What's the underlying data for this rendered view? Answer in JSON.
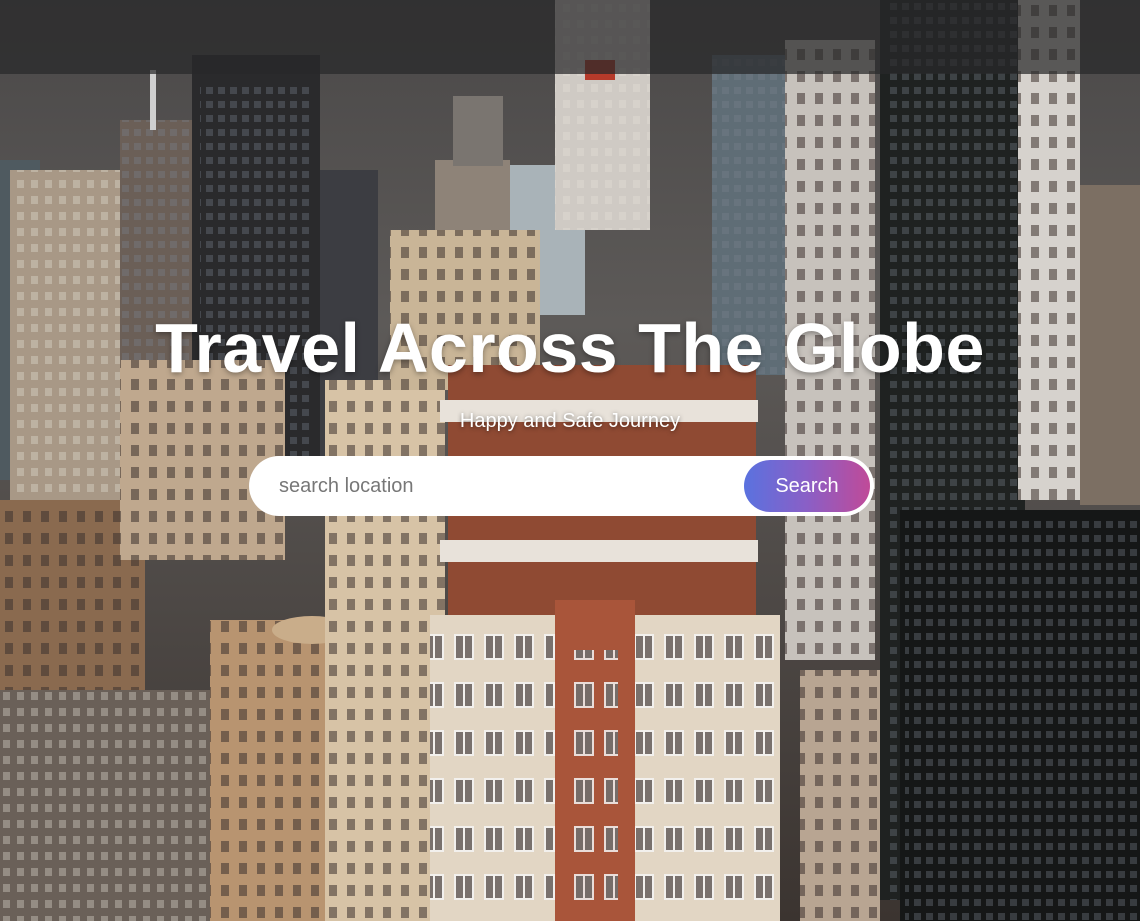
{
  "hero": {
    "title": "Travel Across The Globe",
    "subtitle": "Happy and Safe Journey",
    "background_image": "city-skyline-photo"
  },
  "search": {
    "placeholder": "search location",
    "value": "",
    "button_label": "Search"
  },
  "colors": {
    "overlay": "#28282a",
    "text": "#ffffff",
    "search_bg": "#ffffff",
    "button_gradient_start": "#5a72df",
    "button_gradient_end": "#c04a98"
  }
}
